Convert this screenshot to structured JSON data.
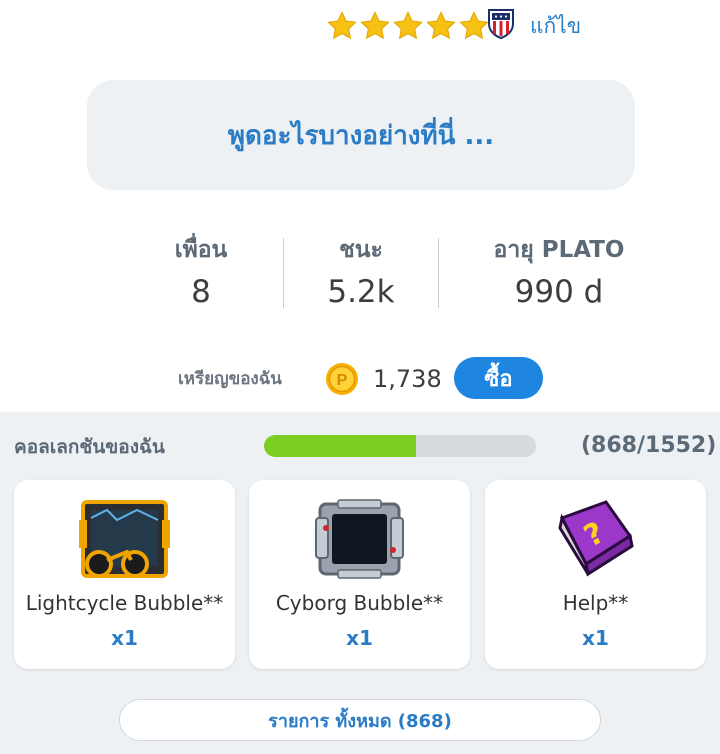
{
  "profile": {
    "rating_stars": 5,
    "edit_label": "แก้ไข",
    "status_placeholder": "พูดอะไรบางอย่างที่นี่ ..."
  },
  "stats": [
    {
      "label": "เพื่อน",
      "value": "8"
    },
    {
      "label": "ชนะ",
      "value": "5.2k"
    },
    {
      "label": "อายุ PLATO",
      "value": "990 d"
    }
  ],
  "coins": {
    "label": "เหรียญของฉัน",
    "count": "1,738",
    "buy_label": "ซื้อ",
    "icon": "coin-icon"
  },
  "collection": {
    "label": "คอลเลกชันของฉัน",
    "progress_text": "(868/1552)",
    "progress_fraction": 0.5593,
    "items": [
      {
        "name": "Lightcycle Bubble**",
        "qty": "x1",
        "icon": "lightcycle-bubble-icon"
      },
      {
        "name": "Cyborg Bubble**",
        "qty": "x1",
        "icon": "cyborg-bubble-icon"
      },
      {
        "name": "Help**",
        "qty": "x1",
        "icon": "help-book-icon"
      }
    ],
    "view_all_label": "รายการ ทั้งหมด (868)"
  },
  "colors": {
    "accent": "#2a7cc7",
    "buy_button": "#1e85e0",
    "progress": "#7ccf22",
    "star": "#f6c114",
    "panel_bg": "#eef1f4"
  }
}
